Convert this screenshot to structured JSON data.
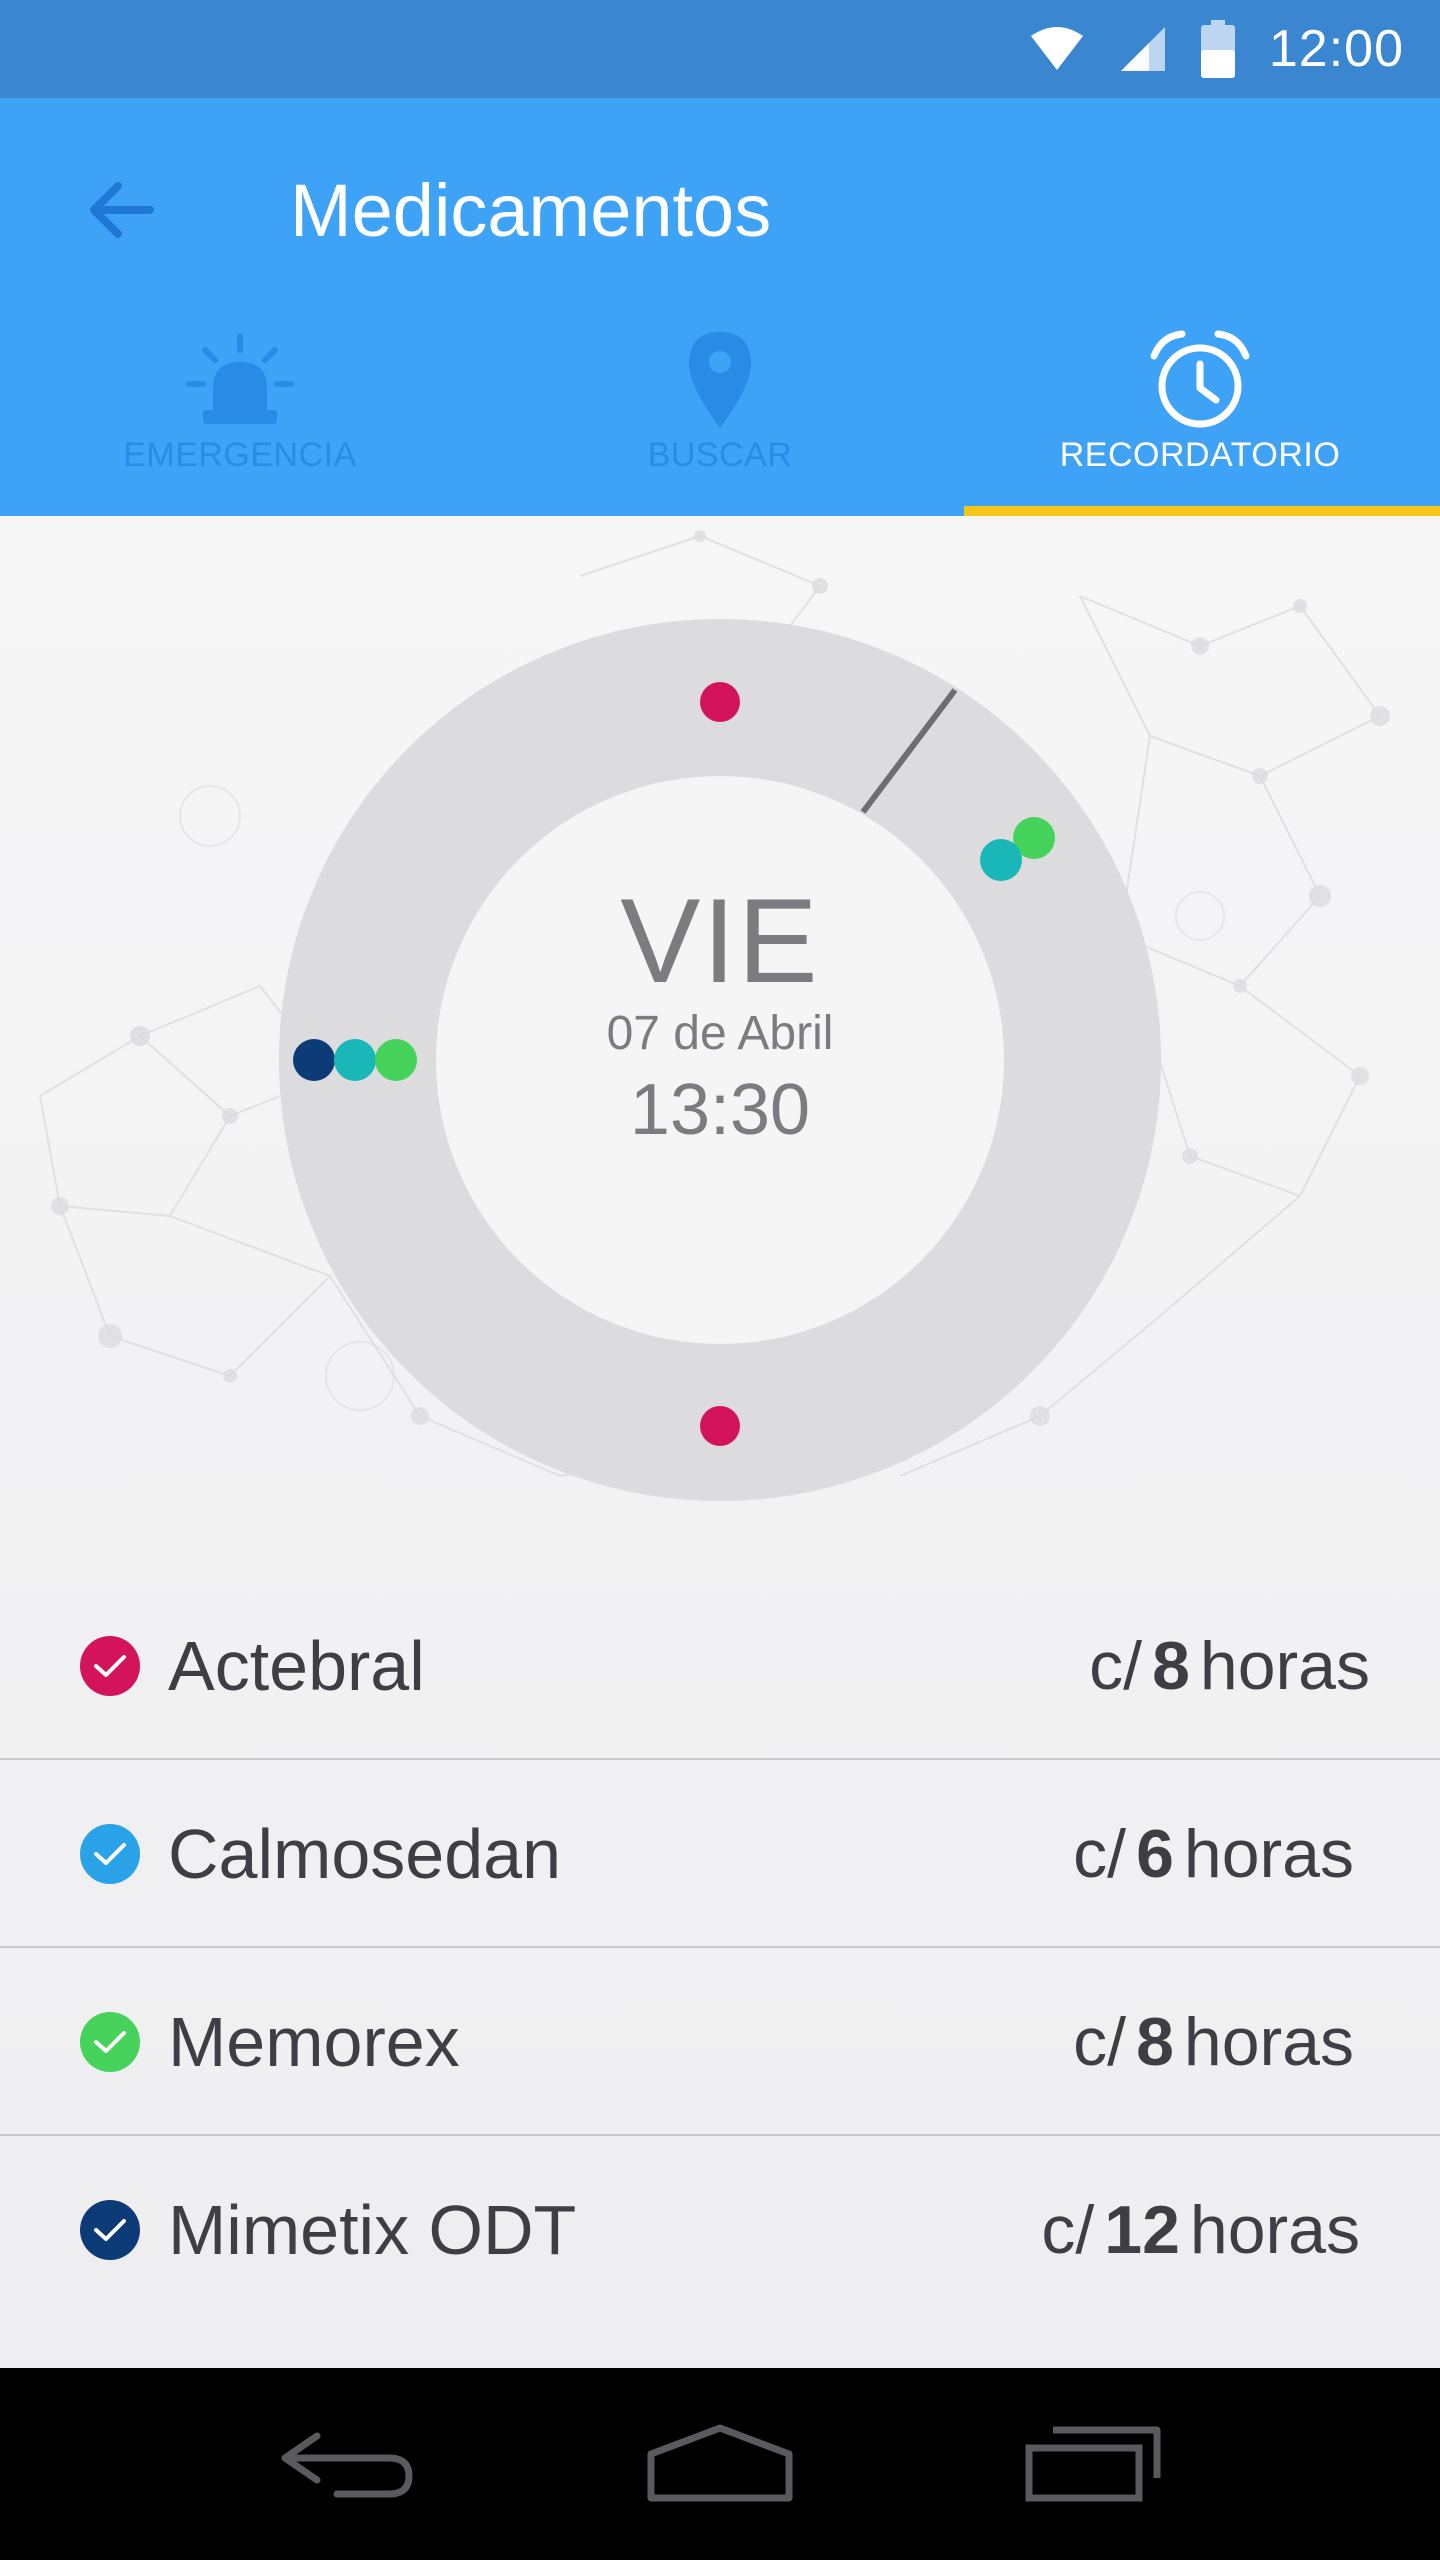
{
  "status_bar": {
    "time": "12:00",
    "icons": [
      "wifi-icon",
      "signal-icon",
      "battery-icon"
    ]
  },
  "app_bar": {
    "title": "Medicamentos",
    "back_icon": "arrow-left-icon",
    "tabs": [
      {
        "label": "EMERGENCIA",
        "icon": "siren-icon",
        "active": false
      },
      {
        "label": "BUSCAR",
        "icon": "map-pin-icon",
        "active": false
      },
      {
        "label": "RECORDATORIO",
        "icon": "alarm-clock-icon",
        "active": true
      }
    ]
  },
  "colors": {
    "status_bar": "#3a86d0",
    "app_bar": "#3ea3f6",
    "tab_indicator": "#f5c518",
    "actebral": "#d3145a",
    "calmosedan": "#2aa2e8",
    "memorex": "#45d35b",
    "mimetix": "#0d3b78",
    "teal": "#1ab7b9",
    "ring": "#dcdbde"
  },
  "schedule": {
    "day": "VIE",
    "date": "07 de Abril",
    "time": "13:30"
  },
  "medications": [
    {
      "name": "Actebral",
      "prefix": "c/",
      "interval": "8",
      "unit": "horas",
      "color": "#d3145a"
    },
    {
      "name": "Calmosedan",
      "prefix": "c/",
      "interval": "6",
      "unit": "horas",
      "color": "#2aa2e8"
    },
    {
      "name": "Memorex",
      "prefix": "c/",
      "interval": "8",
      "unit": "horas",
      "color": "#45d35b"
    },
    {
      "name": "Mimetix ODT",
      "prefix": "c/",
      "interval": "12",
      "unit": "horas",
      "color": "#0d3b78"
    }
  ],
  "nav_bar": {
    "icons": [
      "nav-back-icon",
      "nav-home-icon",
      "nav-recents-icon"
    ]
  }
}
